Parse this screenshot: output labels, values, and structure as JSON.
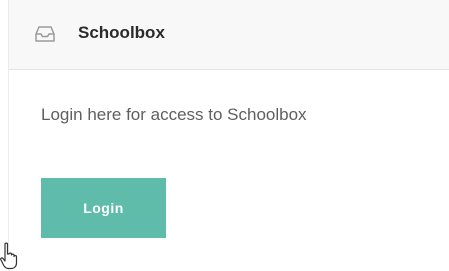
{
  "header": {
    "icon": "inbox-tray-icon",
    "title": "Schoolbox"
  },
  "main": {
    "message": "Login here for access to Schoolbox",
    "login_button_label": "Login"
  },
  "colors": {
    "accent": "#5fbcaa",
    "header_background": "#f8f8f8",
    "title_text": "#2b2b2b",
    "body_text": "#5f5f5f"
  },
  "cursor": {
    "icon": "hand-pointer-cursor"
  }
}
